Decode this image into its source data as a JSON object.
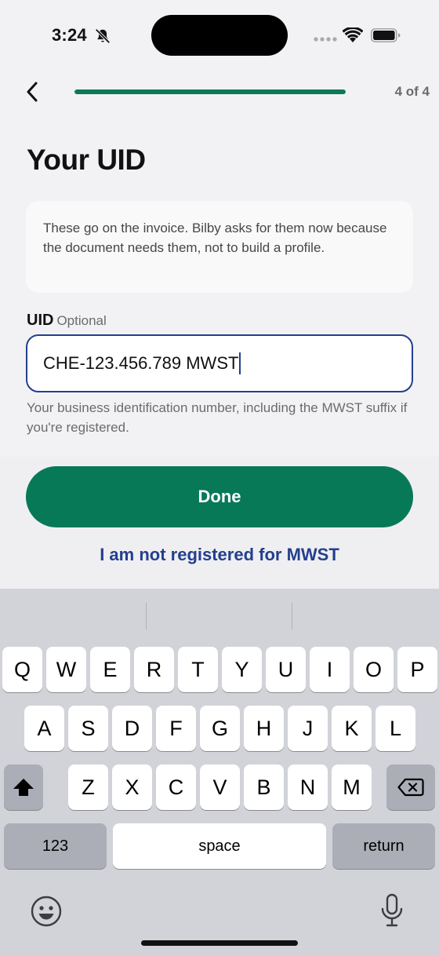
{
  "status_bar": {
    "time": "3:24"
  },
  "header": {
    "step_count": "4 of 4",
    "progress_fraction": 1.0
  },
  "page": {
    "title": "Your UID",
    "info": "These go on the invoice. Bilby asks for them now because the document needs them, not to build a profile."
  },
  "uid_field": {
    "label": "UID",
    "optional_label": "Optional",
    "value": "CHE-123.456.789 MWST",
    "help": "Your business identification number, including the MWST suffix if you're registered."
  },
  "actions": {
    "done_label": "Done",
    "not_registered_label": "I am not registered for MWST"
  },
  "colors": {
    "primary_green": "#087957",
    "link_blue": "#233f8e"
  },
  "keyboard": {
    "row1": [
      "Q",
      "W",
      "E",
      "R",
      "T",
      "Y",
      "U",
      "I",
      "O",
      "P"
    ],
    "row2": [
      "A",
      "S",
      "D",
      "F",
      "G",
      "H",
      "J",
      "K",
      "L"
    ],
    "row3": [
      "Z",
      "X",
      "C",
      "V",
      "B",
      "N",
      "M"
    ],
    "numbers_label": "123",
    "space_label": "space",
    "return_label": "return"
  }
}
